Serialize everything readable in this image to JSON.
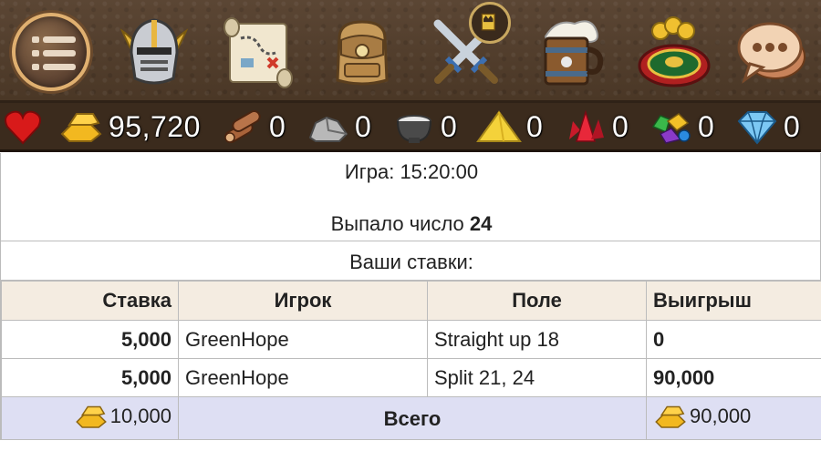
{
  "nav": {
    "items": [
      {
        "name": "menu-icon"
      },
      {
        "name": "knight-helmet-icon"
      },
      {
        "name": "treasure-map-icon"
      },
      {
        "name": "backpack-icon"
      },
      {
        "name": "crossed-swords-icon"
      },
      {
        "name": "tavern-mug-icon"
      },
      {
        "name": "roulette-icon"
      },
      {
        "name": "chat-bubble-icon"
      }
    ],
    "clan_badge_icon": "crown-banner-icon"
  },
  "resources": {
    "gold": "95,720",
    "wood": "0",
    "stone": "0",
    "iron": "0",
    "sulfur": "0",
    "crystal": "0",
    "gems": "0",
    "diamonds": "0"
  },
  "game": {
    "time_text": "Игра: 15:20:00",
    "result_label": "Выпало число",
    "result_number": "24",
    "bets_title": "Ваши ставки:"
  },
  "table": {
    "headers": {
      "stake": "Ставка",
      "player": "Игрок",
      "field": "Поле",
      "win": "Выигрыш"
    },
    "rows": [
      {
        "stake": "5,000",
        "player": "GreenHope",
        "field": "Straight up 18",
        "win": "0"
      },
      {
        "stake": "5,000",
        "player": "GreenHope",
        "field": "Split 21, 24",
        "win": "90,000"
      }
    ],
    "footer": {
      "stake_total": "10,000",
      "label": "Всего",
      "win_total": "90,000"
    }
  },
  "colors": {
    "nav_bg": "#4f3b2a",
    "resource_bar_bg": "#3b2b1d",
    "table_header_bg": "#f4ece1",
    "table_footer_bg": "#dedff3",
    "gold": "#f2b820"
  }
}
